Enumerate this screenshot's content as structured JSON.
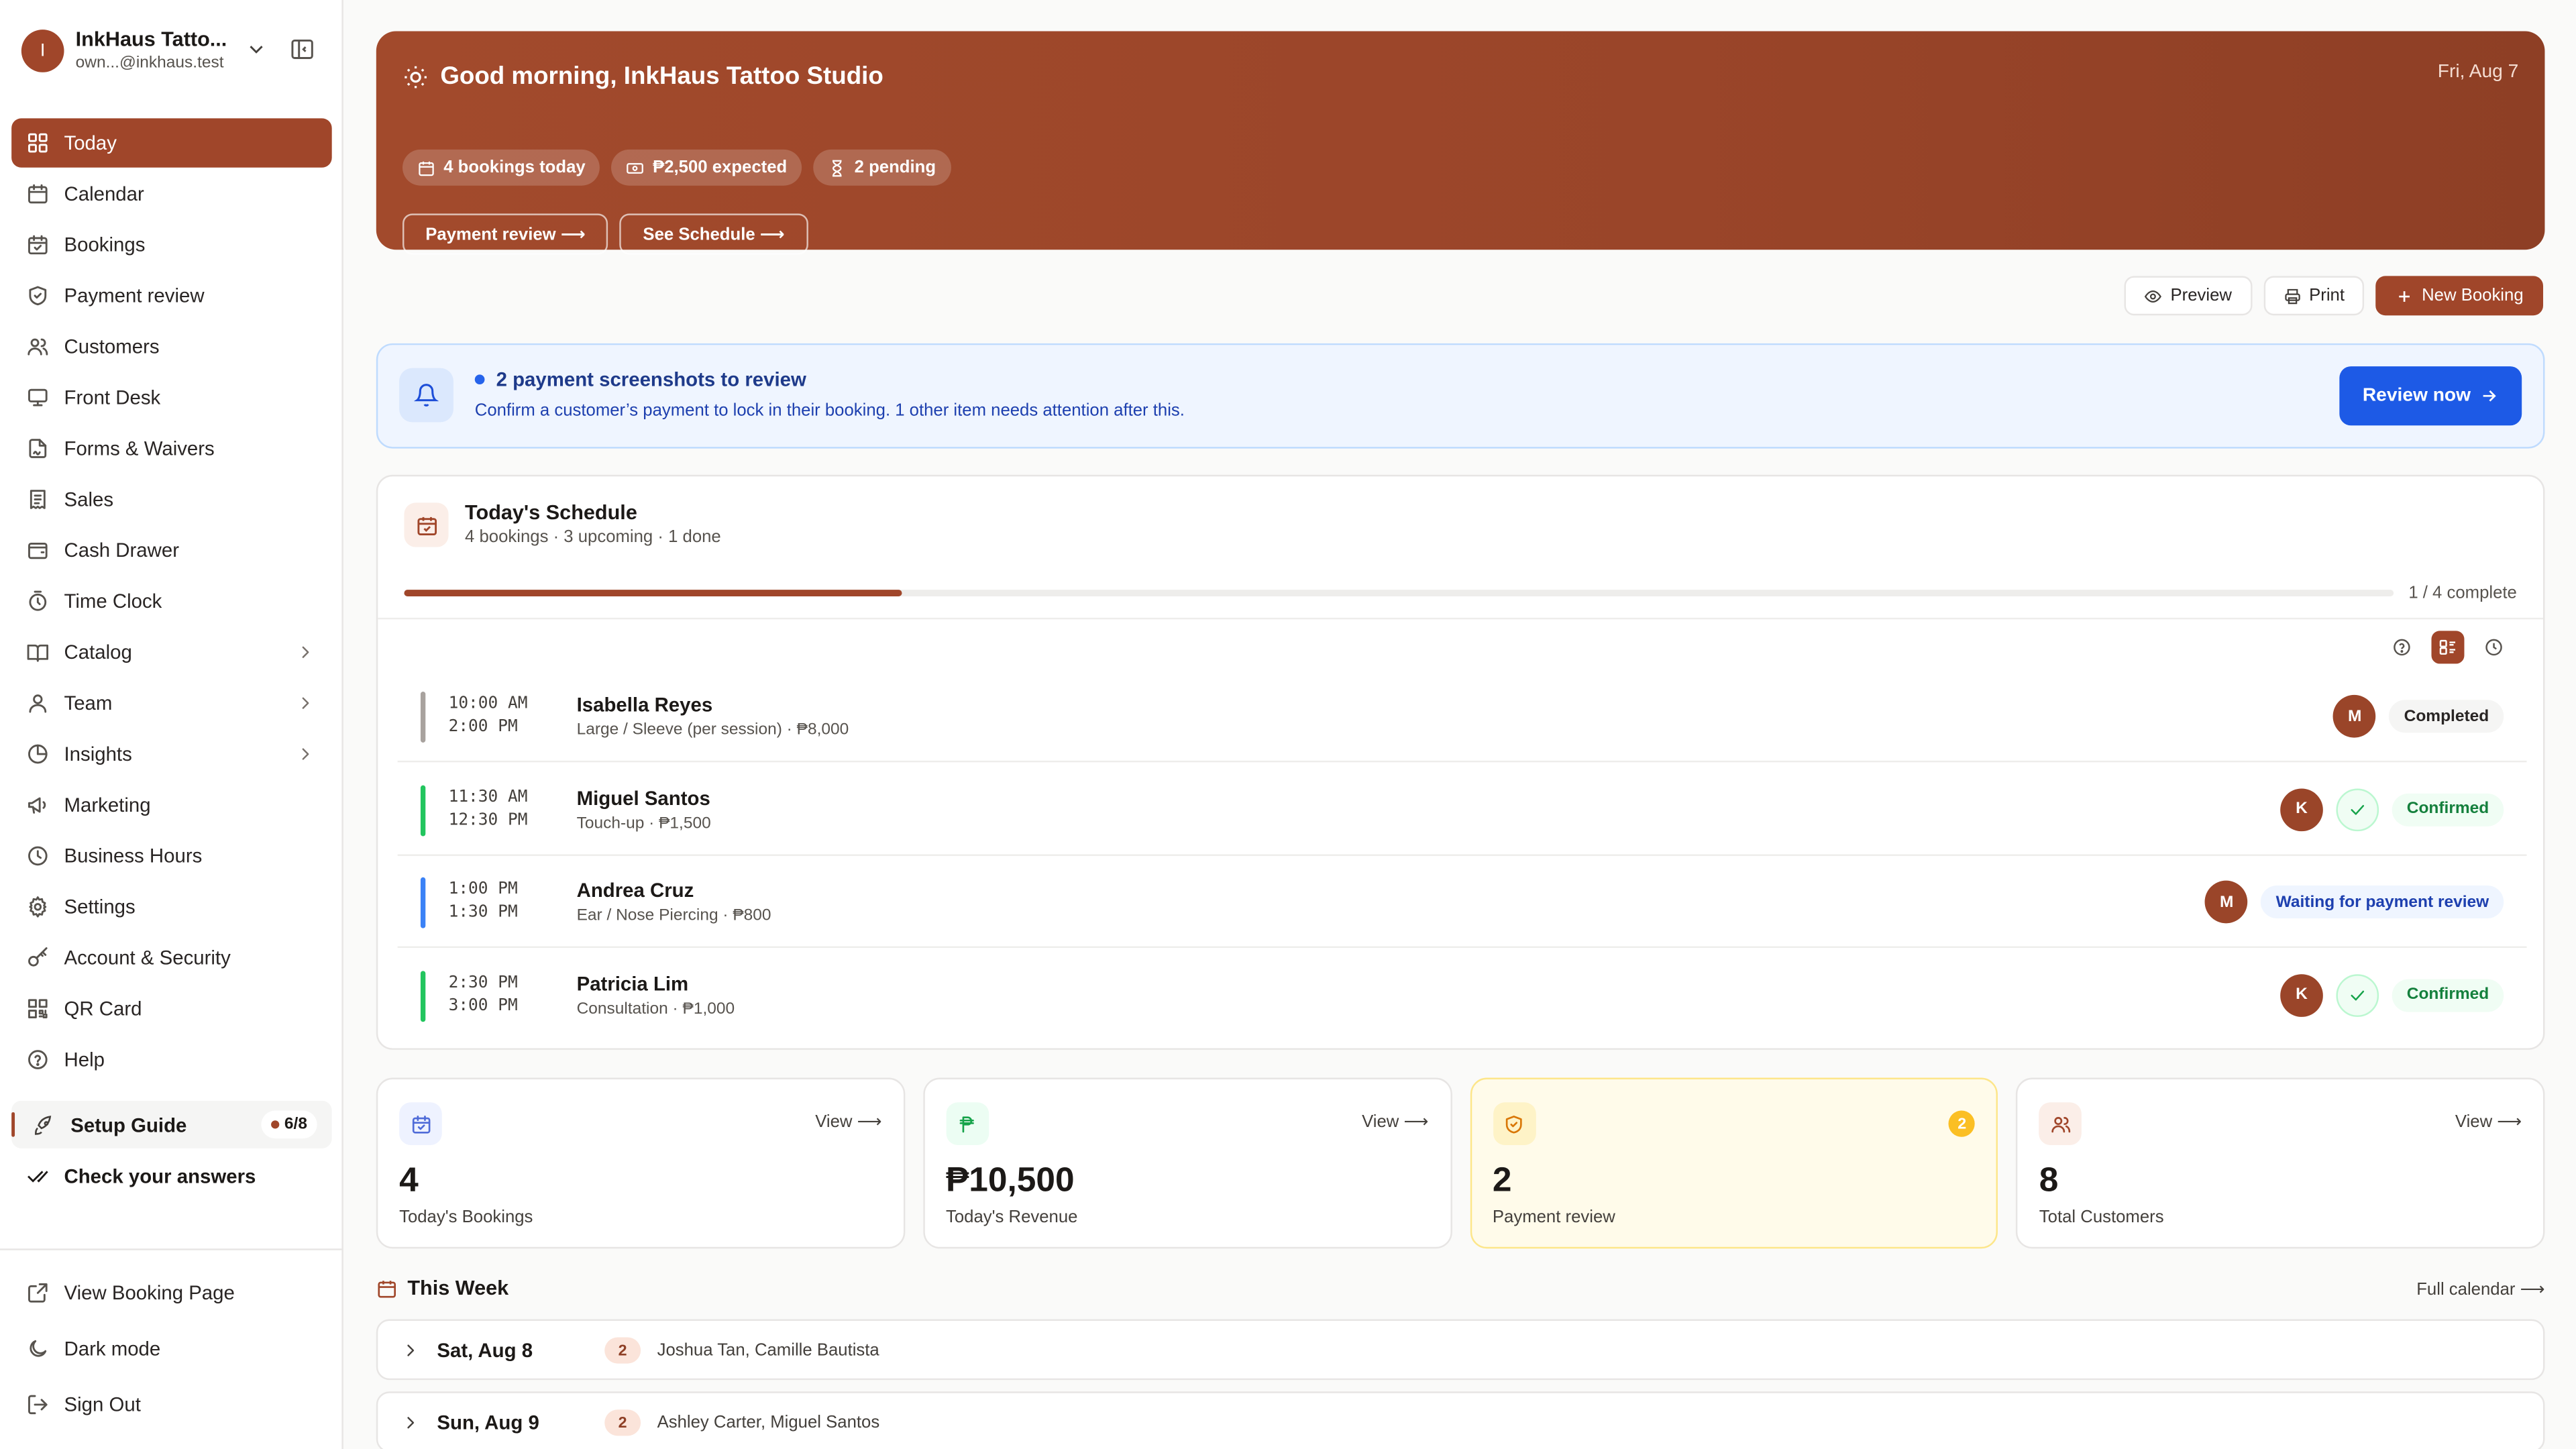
{
  "account": {
    "initial": "I",
    "name": "InkHaus Tatto...",
    "email": "own...@inkhaus.test"
  },
  "nav": [
    {
      "label": "Today",
      "icon": "grid-icon",
      "active": true
    },
    {
      "label": "Calendar",
      "icon": "calendar-icon"
    },
    {
      "label": "Bookings",
      "icon": "calendar-check-icon"
    },
    {
      "label": "Payment review",
      "icon": "shield-icon"
    },
    {
      "label": "Customers",
      "icon": "users-icon"
    },
    {
      "label": "Front Desk",
      "icon": "monitor-icon"
    },
    {
      "label": "Forms & Waivers",
      "icon": "file-signature-icon"
    },
    {
      "label": "Sales",
      "icon": "receipt-icon"
    },
    {
      "label": "Cash Drawer",
      "icon": "wallet-icon"
    },
    {
      "label": "Time Clock",
      "icon": "timer-icon"
    },
    {
      "label": "Catalog",
      "icon": "book-open-icon",
      "expandable": true
    },
    {
      "label": "Team",
      "icon": "user-icon",
      "expandable": true
    },
    {
      "label": "Insights",
      "icon": "pie-chart-icon",
      "expandable": true
    },
    {
      "label": "Marketing",
      "icon": "megaphone-icon"
    },
    {
      "label": "Business Hours",
      "icon": "clock-icon"
    },
    {
      "label": "Settings",
      "icon": "gear-icon"
    },
    {
      "label": "Account & Security",
      "icon": "key-icon"
    },
    {
      "label": "QR Card",
      "icon": "qr-code-icon"
    },
    {
      "label": "Help",
      "icon": "help-circle-icon"
    }
  ],
  "setup": {
    "label": "Setup Guide",
    "progress": "6/8"
  },
  "check_answers": "Check your answers",
  "bottom_nav": [
    {
      "label": "View Booking Page",
      "icon": "external-link-icon"
    },
    {
      "label": "Dark mode",
      "icon": "moon-icon"
    },
    {
      "label": "Sign Out",
      "icon": "sign-out-icon"
    }
  ],
  "hero": {
    "greeting": "Good morning, InkHaus Tattoo Studio",
    "date": "Fri, Aug 7",
    "chips": [
      {
        "label": "4 bookings today",
        "icon": "calendar-icon"
      },
      {
        "label": "₱2,500 expected",
        "icon": "banknote-icon"
      },
      {
        "label": "2 pending",
        "icon": "hourglass-icon"
      }
    ],
    "buttons": [
      "Payment review ⟶",
      "See Schedule ⟶"
    ]
  },
  "toolbar": {
    "preview": "Preview",
    "print": "Print",
    "new_booking": "New Booking"
  },
  "alert": {
    "title": "2 payment screenshots to review",
    "subtitle": "Confirm a customer’s payment to lock in their booking. 1 other item needs attention after this.",
    "button": "Review now"
  },
  "schedule": {
    "title": "Today's Schedule",
    "subtitle": "4 bookings · 3 upcoming · 1 done",
    "progress_fraction": 0.25,
    "complete_label": "1 / 4 complete",
    "appointments": [
      {
        "start": "10:00 AM",
        "end": "2:00 PM",
        "name": "Isabella Reyes",
        "desc": "Large / Sleeve (per session) · ₱8,000",
        "staff": "M",
        "status": "Completed",
        "status_kind": "completed",
        "bar_color": "#a8a29e",
        "checked_in": false
      },
      {
        "start": "11:30 AM",
        "end": "12:30 PM",
        "name": "Miguel Santos",
        "desc": "Touch-up · ₱1,500",
        "staff": "K",
        "status": "Confirmed",
        "status_kind": "confirmed",
        "bar_color": "#22c55e",
        "checked_in": true
      },
      {
        "start": "1:00 PM",
        "end": "1:30 PM",
        "name": "Andrea Cruz",
        "desc": "Ear / Nose Piercing · ₱800",
        "staff": "M",
        "status": "Waiting for payment review",
        "status_kind": "waiting",
        "bar_color": "#3b82f6",
        "checked_in": false
      },
      {
        "start": "2:30 PM",
        "end": "3:00 PM",
        "name": "Patricia Lim",
        "desc": "Consultation · ₱1,000",
        "staff": "K",
        "status": "Confirmed",
        "status_kind": "confirmed",
        "bar_color": "#22c55e",
        "checked_in": true
      }
    ]
  },
  "stats": [
    {
      "value": "4",
      "label": "Today's Bookings",
      "action": "View ⟶",
      "icon": "calendar-check-icon",
      "icon_bg": "#eef2ff",
      "icon_color": "#4f6bd8"
    },
    {
      "value": "₱10,500",
      "label": "Today's Revenue",
      "action": "View ⟶",
      "icon": "peso-icon",
      "icon_bg": "#ecfdf3",
      "icon_color": "#16a34a"
    },
    {
      "value": "2",
      "label": "Payment review",
      "count": "2",
      "icon": "shield-icon",
      "icon_bg": "#fef3c7",
      "icon_color": "#d97706",
      "warn": true
    },
    {
      "value": "8",
      "label": "Total Customers",
      "action": "View ⟶",
      "icon": "users-icon",
      "icon_bg": "#fbeee8",
      "icon_color": "#a0462a"
    }
  ],
  "week": {
    "title": "This Week",
    "link": "Full calendar ⟶",
    "days": [
      {
        "label": "Sat, Aug 8",
        "count": "2",
        "names": "Joshua Tan, Camille Bautista"
      },
      {
        "label": "Sun, Aug 9",
        "count": "2",
        "names": "Ashley Carter, Miguel Santos"
      }
    ]
  }
}
